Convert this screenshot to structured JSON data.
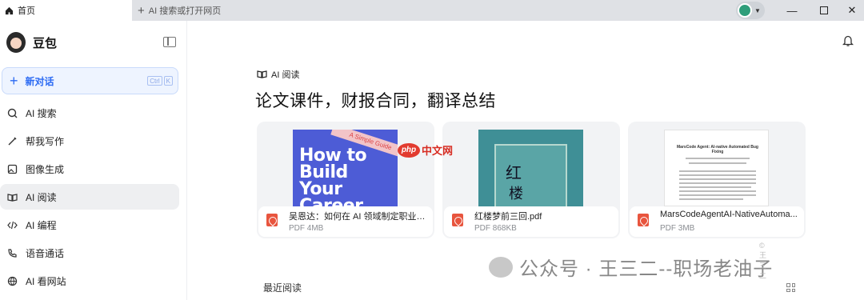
{
  "browser": {
    "active_tab_label": "首页",
    "new_tab_label": "AI 搜索或打开网页"
  },
  "sidebar": {
    "profile_name": "豆包",
    "new_chat": {
      "label": "新对话",
      "shortcut_keys": [
        "Ctrl",
        "K"
      ]
    },
    "items": [
      {
        "label": "AI 搜索",
        "icon": "ai-search-icon"
      },
      {
        "label": "帮我写作",
        "icon": "pen-icon"
      },
      {
        "label": "图像生成",
        "icon": "image-icon"
      },
      {
        "label": "AI 阅读",
        "icon": "read-icon",
        "active": true
      },
      {
        "label": "AI 编程",
        "icon": "code-icon"
      },
      {
        "label": "语音通话",
        "icon": "phone-icon"
      },
      {
        "label": "AI 看网站",
        "icon": "globe-icon"
      }
    ]
  },
  "main": {
    "section_tag": "AI 阅读",
    "headline": "论文课件，财报合同，翻译总结",
    "cards": [
      {
        "name": "吴恩达：如何在 AI 领域制定职业规...",
        "meta": "PDF 4MB",
        "cover_lines": [
          "How to",
          "Build",
          "Your",
          "Career"
        ],
        "ribbon": "A Simple Guide"
      },
      {
        "name": "红楼梦前三回.pdf",
        "meta": "PDF 868KB",
        "cover_lines": [
          "红",
          "楼"
        ]
      },
      {
        "name": "MarsCodeAgentAI-NativeAutoma...",
        "meta": "PDF 3MB",
        "cover_title": "MarsCode Agent: AI-native Automated Bug Fixing"
      }
    ],
    "recent_label": "最近阅读"
  },
  "overlays": {
    "php_logo": "php",
    "php_text": "中文网",
    "watermark_text": "公众号 · 王三二--职场老油子",
    "watermark_small": "© 王三二"
  },
  "colors": {
    "accent": "#2b6af3",
    "pdf_red": "#e8553e"
  }
}
